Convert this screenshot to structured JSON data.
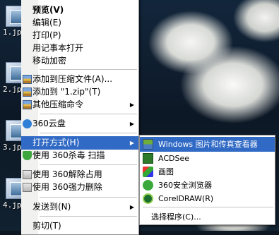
{
  "desktop": {
    "icons": [
      {
        "label": "1.jp"
      },
      {
        "label": "2.jp"
      },
      {
        "label": "3.jp"
      },
      {
        "label": "4.jp"
      }
    ]
  },
  "context_menu": {
    "items": [
      {
        "label": "预览(V)",
        "icon": "none",
        "bold": true
      },
      {
        "label": "编辑(E)",
        "icon": "none"
      },
      {
        "label": "打印(P)",
        "icon": "none"
      },
      {
        "label": "用记事本打开",
        "icon": "none"
      },
      {
        "label": "移动加密",
        "icon": "none"
      },
      {
        "label": "添加到压缩文件(A)...",
        "icon": "winrar-icon"
      },
      {
        "label": "添加到 \"1.zip\"(T)",
        "icon": "winrar-icon"
      },
      {
        "label": "其他压缩命令",
        "icon": "winrar-icon",
        "submenu": true
      },
      {
        "label": "360云盘",
        "icon": "360-cloud-icon",
        "submenu": true
      },
      {
        "label": "打开方式(H)",
        "icon": "none",
        "submenu": true,
        "highlighted": true
      },
      {
        "label": "使用 360杀毒 扫描",
        "icon": "360-antivirus-icon"
      },
      {
        "label": "使用 360解除占用",
        "icon": "unlock-icon"
      },
      {
        "label": "使用 360强力删除",
        "icon": "shred-icon"
      },
      {
        "label": "发送到(N)",
        "icon": "none",
        "submenu": true
      },
      {
        "label": "剪切(T)",
        "icon": "none"
      }
    ],
    "submenu_arrow": "▶"
  },
  "open_with_menu": {
    "items": [
      {
        "label": "Windows 图片和传真查看器",
        "icon": "image-viewer-icon",
        "highlighted": true
      },
      {
        "label": "ACDSee",
        "icon": "acdsee-icon"
      },
      {
        "label": "画图",
        "icon": "paint-icon"
      },
      {
        "label": "360安全浏览器",
        "icon": "360-browser-icon"
      },
      {
        "label": "CorelDRAW(R)",
        "icon": "coreldraw-icon"
      },
      {
        "label": "选择程序(C)...",
        "icon": "none"
      }
    ]
  },
  "colors": {
    "highlight": "#316ac5",
    "menu_bg": "#ffffff"
  }
}
